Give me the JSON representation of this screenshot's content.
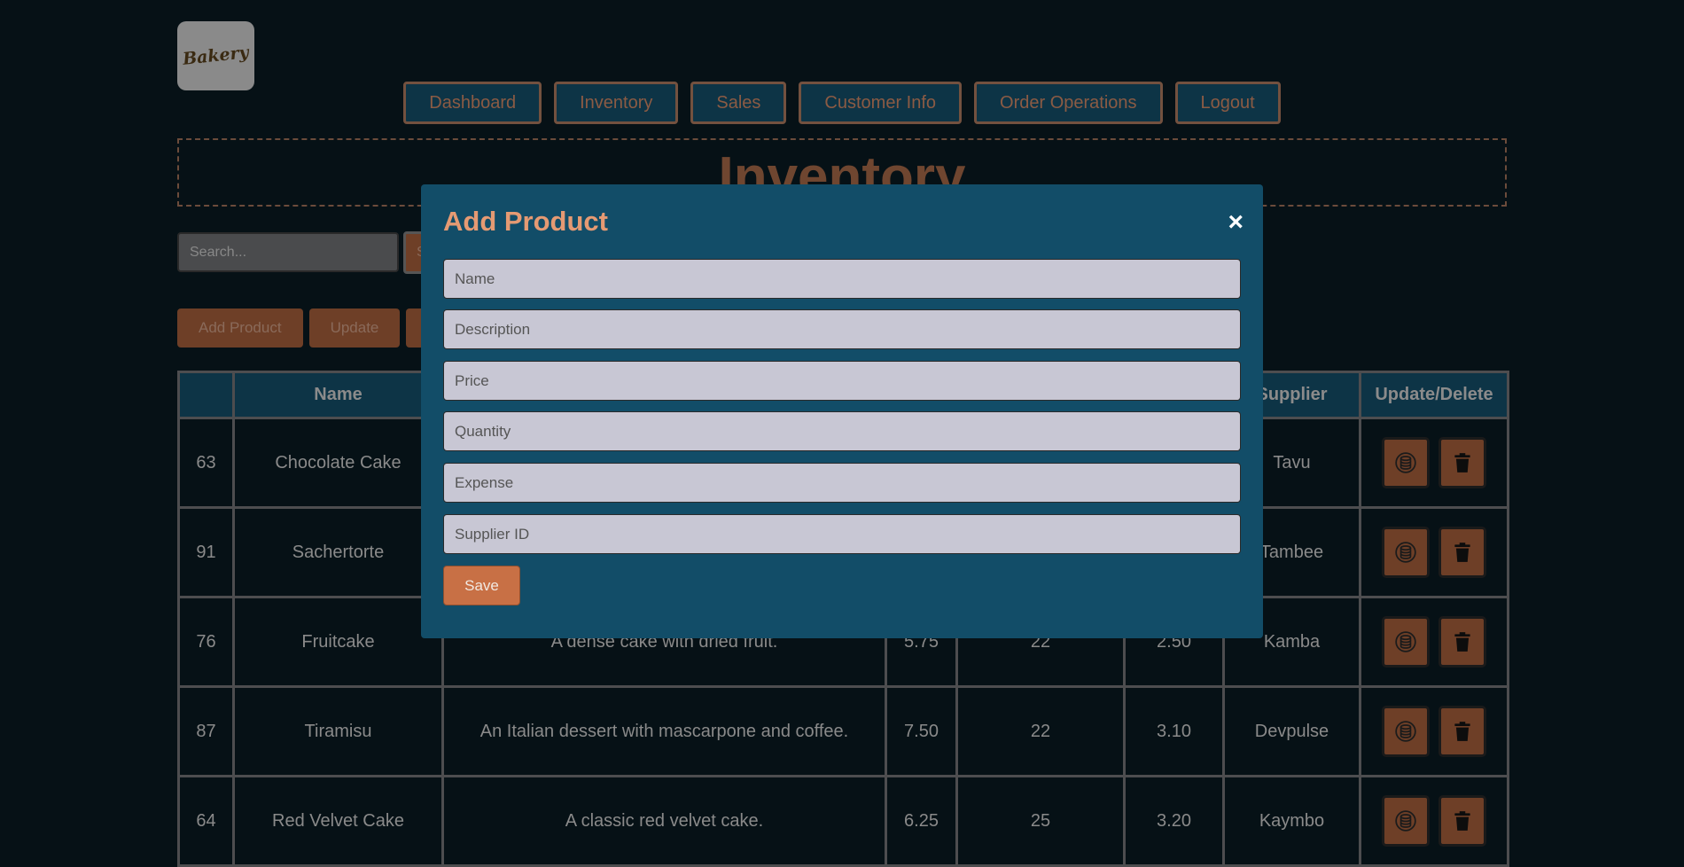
{
  "logo": {
    "text": "Bakery"
  },
  "nav": [
    "Dashboard",
    "Inventory",
    "Sales",
    "Customer Info",
    "Order Operations",
    "Logout"
  ],
  "page_title": "Inventory",
  "search": {
    "placeholder": "Search...",
    "button_label": "S"
  },
  "actions": [
    "Add Product",
    "Update",
    ""
  ],
  "table": {
    "headers": [
      "",
      "Name",
      "",
      "",
      "",
      "",
      "Supplier",
      "Update/Delete"
    ],
    "rows": [
      {
        "id": "63",
        "name": "Chocolate Cake",
        "description": "",
        "price": "",
        "quantity": "",
        "expense": "",
        "supplier": "Tavu"
      },
      {
        "id": "91",
        "name": "Sachertorte",
        "description": "",
        "price": "",
        "quantity": "",
        "expense": "",
        "supplier": "Tambee"
      },
      {
        "id": "76",
        "name": "Fruitcake",
        "description": "A dense cake with dried fruit.",
        "price": "5.75",
        "quantity": "22",
        "expense": "2.50",
        "supplier": "Kamba"
      },
      {
        "id": "87",
        "name": "Tiramisu",
        "description": "An Italian dessert with mascarpone and coffee.",
        "price": "7.50",
        "quantity": "22",
        "expense": "3.10",
        "supplier": "Devpulse"
      },
      {
        "id": "64",
        "name": "Red Velvet Cake",
        "description": "A classic red velvet cake.",
        "price": "6.25",
        "quantity": "25",
        "expense": "3.20",
        "supplier": "Kaymbo"
      }
    ],
    "row_icons": [
      "database-icon",
      "trash-icon"
    ]
  },
  "modal": {
    "title": "Add Product",
    "close": "×",
    "fields": [
      "Name",
      "Description",
      "Price",
      "Quantity",
      "Expense",
      "Supplier ID"
    ],
    "save_label": "Save"
  },
  "colors": {
    "background": "#061116",
    "panel": "#124d68",
    "accent": "#c87045",
    "field": "#c8c7d4"
  }
}
